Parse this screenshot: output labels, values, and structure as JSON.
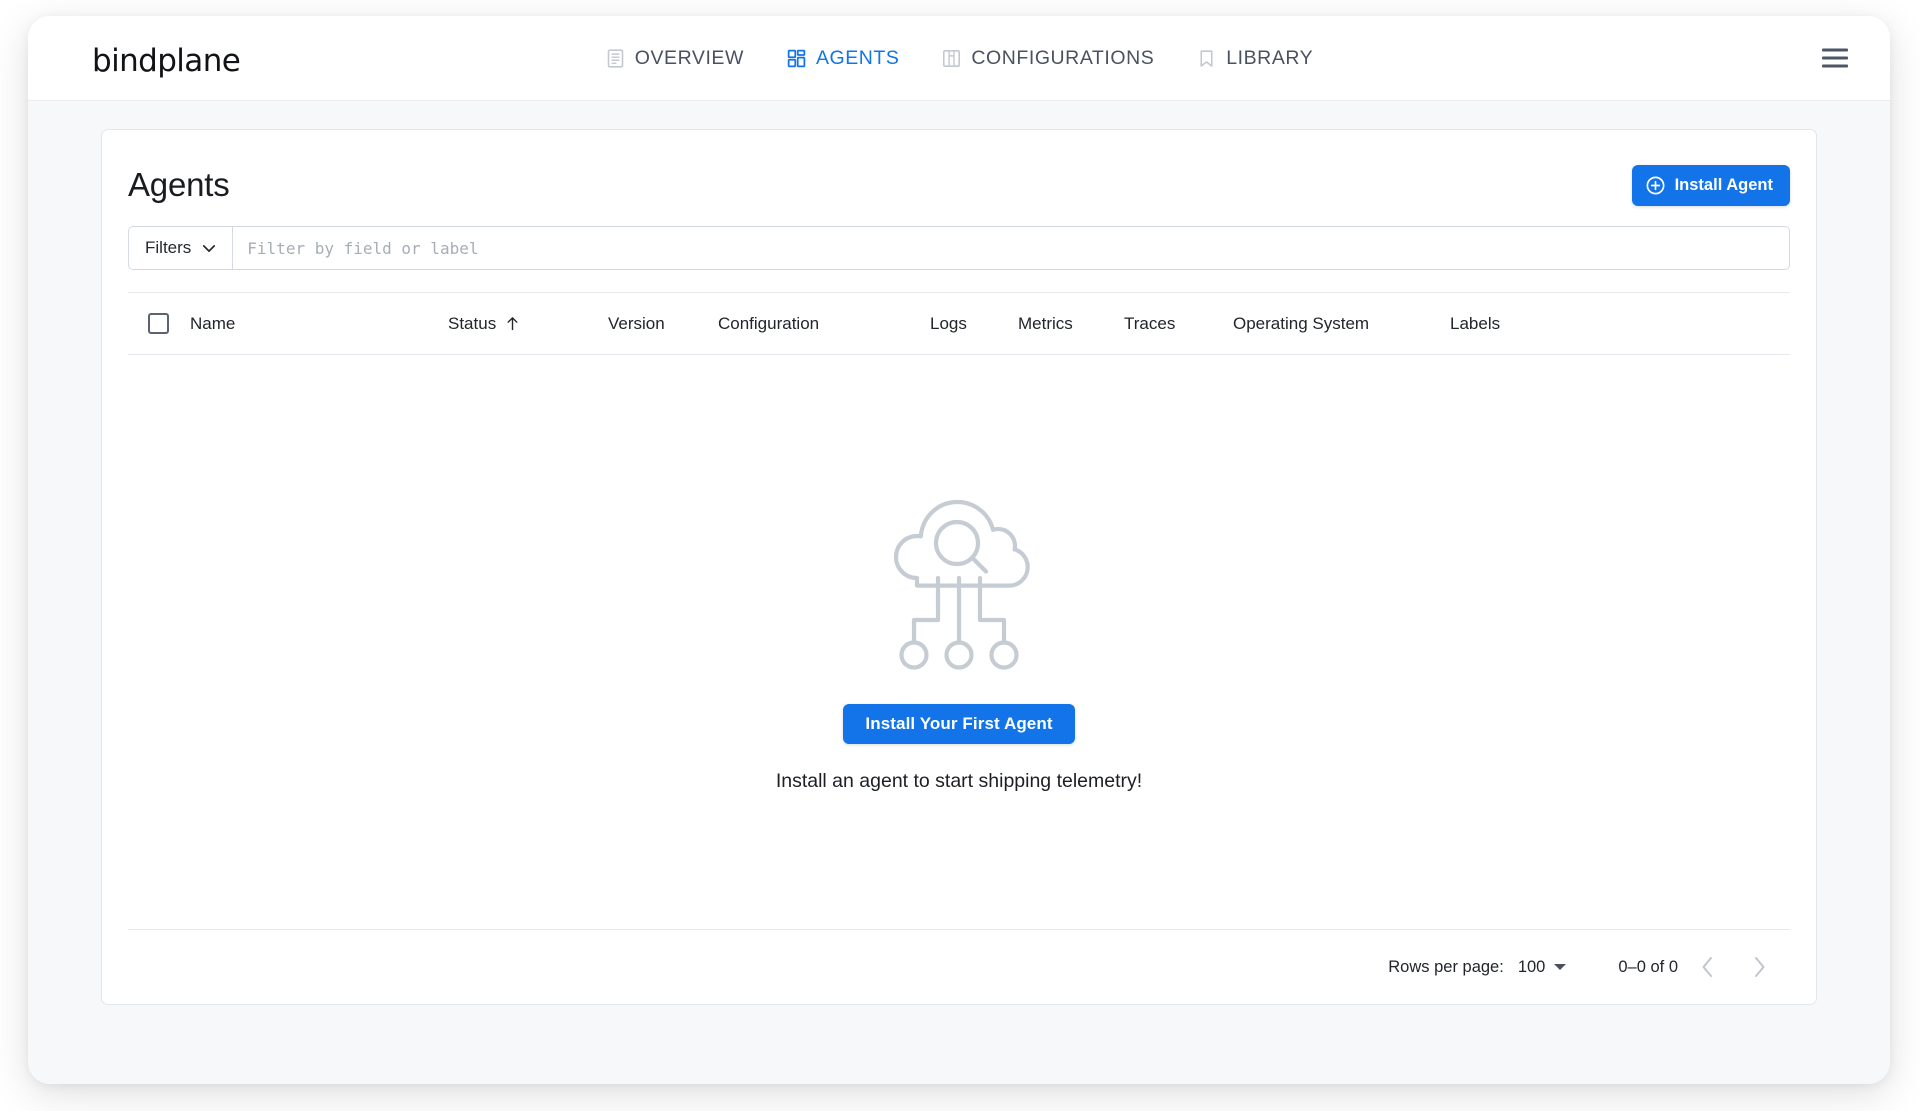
{
  "brand": "bindplane",
  "nav": {
    "items": [
      {
        "label": "OVERVIEW",
        "icon": "document-lines-icon",
        "active": false
      },
      {
        "label": "AGENTS",
        "icon": "grid-squares-icon",
        "active": true
      },
      {
        "label": "CONFIGURATIONS",
        "icon": "configuration-grid-icon",
        "active": false
      },
      {
        "label": "LIBRARY",
        "icon": "bookmark-icon",
        "active": false
      }
    ],
    "menu_icon": "hamburger-menu-icon"
  },
  "page": {
    "title": "Agents",
    "install_agent_label": "Install Agent",
    "install_agent_icon": "plus-circle-icon"
  },
  "filters": {
    "button_label": "Filters",
    "dropdown_icon": "chevron-down-icon",
    "input_value": "",
    "input_placeholder": "Filter by field or label"
  },
  "table": {
    "select_all_checkbox": "unchecked",
    "columns": [
      {
        "label": "Name",
        "sorted": false
      },
      {
        "label": "Status",
        "sorted": true,
        "sort_direction": "ascending",
        "sort_icon": "arrow-up-icon"
      },
      {
        "label": "Version",
        "sorted": false
      },
      {
        "label": "Configuration",
        "sorted": false
      },
      {
        "label": "Logs",
        "sorted": false
      },
      {
        "label": "Metrics",
        "sorted": false
      },
      {
        "label": "Traces",
        "sorted": false
      },
      {
        "label": "Operating System",
        "sorted": false
      },
      {
        "label": "Labels",
        "sorted": false
      }
    ],
    "rows": []
  },
  "empty_state": {
    "illustration": "cloud-with-magnifier-and-nodes-icon",
    "cta_label": "Install Your First Agent",
    "caption": "Install an agent to start shipping telemetry!"
  },
  "pagination": {
    "rows_per_page_label": "Rows per page:",
    "rows_per_page_value": "100",
    "rows_per_page_icon": "caret-down-icon",
    "range_text": "0–0 of 0",
    "prev_icon": "chevron-left-icon",
    "next_icon": "chevron-right-icon",
    "prev_enabled": false,
    "next_enabled": false
  },
  "colors": {
    "accent_blue": "#1274e8",
    "text_primary": "#1a1c20",
    "text_nav": "#4a5160",
    "border": "#e3e7ec",
    "page_bg": "#f7f8f9",
    "illustration_gray": "#c6ccd4"
  }
}
